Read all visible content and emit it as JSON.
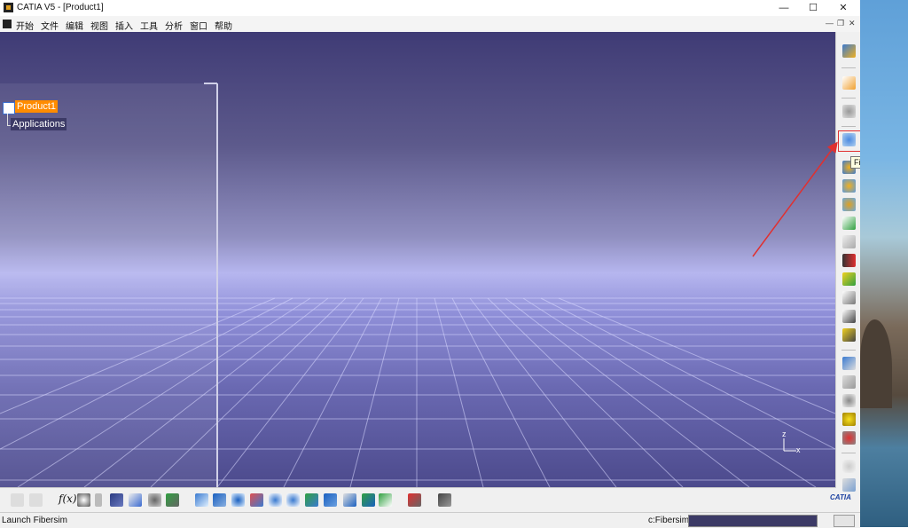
{
  "window": {
    "title": "CATIA V5 - [Product1]",
    "controls": {
      "minimize": "—",
      "maximize": "☐",
      "close": "✕"
    }
  },
  "menubar": {
    "items": [
      "开始",
      "文件",
      "编辑",
      "视图",
      "插入",
      "工具",
      "分析",
      "窗口",
      "帮助"
    ],
    "mdi_controls": {
      "minimize": "—",
      "restore": "❐",
      "close": "✕"
    }
  },
  "tree": {
    "root": "Product1",
    "child": "Applications"
  },
  "compass": {
    "z_label": "z",
    "x_label": "x"
  },
  "right_toolbar": {
    "icons": [
      "workbench-icon",
      "select-icon",
      "snap-icon",
      "fibersim-icon",
      "gear-assembly-icon",
      "gear-move-icon",
      "gear-constraint-icon",
      "save-icon",
      "cut-icon",
      "list-arrow-icon",
      "tree-color-icon",
      "hierarchy-icon",
      "tree-expand-icon",
      "component-icon",
      "view-icon",
      "measure-icon",
      "hide-icon",
      "light-bulb-icon",
      "no-light-icon",
      "rotate-icon",
      "plane-icon"
    ],
    "tooltip": "Fibersim"
  },
  "bottom_toolbar": {
    "fx_label": "f(x)",
    "catia_logo": "CATIA"
  },
  "status": {
    "message": "Launch Fibersim",
    "command_label": "c:Fibersim",
    "command_value": ""
  },
  "colors": {
    "highlight": "#e03030",
    "tree_selected": "#ff8c00",
    "tooltip_bg": "#ffffe1"
  }
}
